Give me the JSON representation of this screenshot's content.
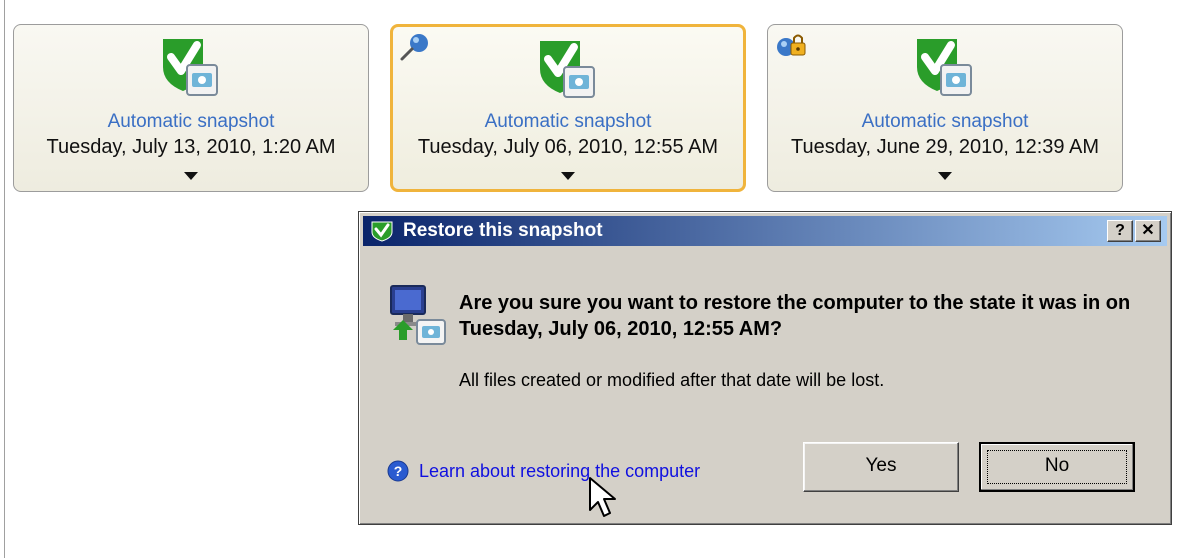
{
  "snapshots": [
    {
      "name": "Automatic snapshot",
      "date": "Tuesday, July 13, 2010, 1:20 AM",
      "selected": false,
      "badge": null
    },
    {
      "name": "Automatic snapshot",
      "date": "Tuesday, July 06, 2010, 12:55 AM",
      "selected": true,
      "badge": "pin-icon"
    },
    {
      "name": "Automatic snapshot",
      "date": "Tuesday, June 29, 2010, 12:39 AM",
      "selected": false,
      "badge": "locked-icon"
    }
  ],
  "dialog": {
    "title": "Restore this snapshot",
    "help_button": "?",
    "close_button": "✕",
    "question": "Are you sure you want to restore the computer to the state it was in on Tuesday, July 06, 2010, 12:55 AM?",
    "warning": "All files created or modified after that date will be lost.",
    "help_link": "Learn about restoring the computer",
    "yes_label": "Yes",
    "no_label": "No"
  },
  "colors": {
    "selected_border": "#f0b43c",
    "title_gradient_start": "#0a246a",
    "title_gradient_end": "#a6caf0",
    "link": "#1010e0",
    "snapshot_name": "#3a6fc4"
  },
  "icons": {
    "snapshot": "shield-check-icon",
    "question": "computer-restore-icon",
    "help": "help-icon",
    "cursor": "mouse-pointer-icon"
  }
}
